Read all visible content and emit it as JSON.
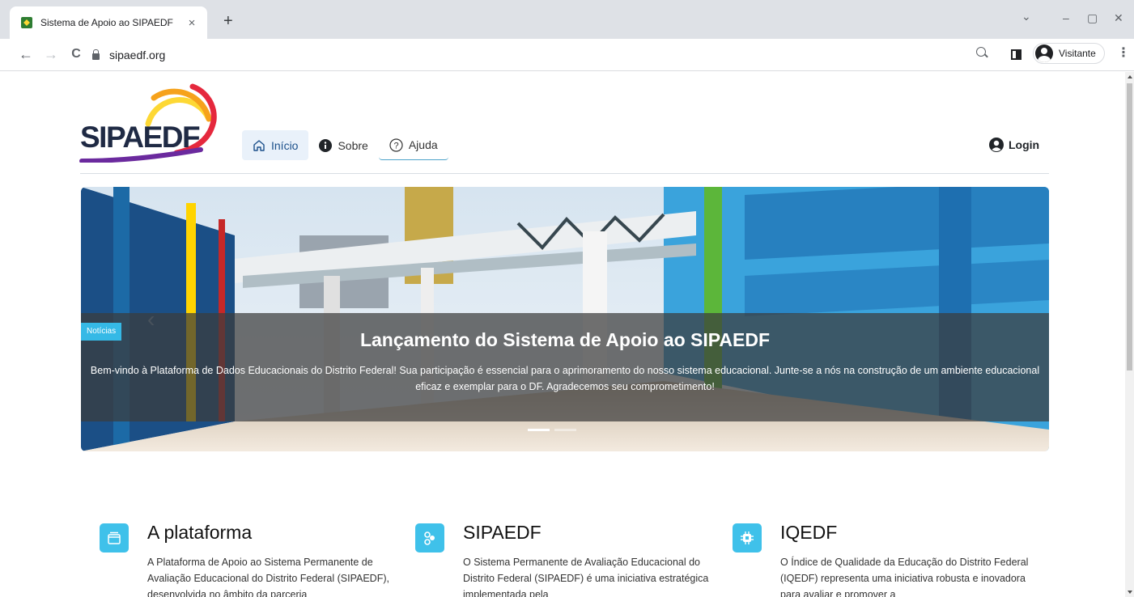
{
  "browser": {
    "tab_title": "Sistema de Apoio ao SIPAEDF",
    "tab_close": "×",
    "new_tab": "+",
    "url": "sipaedf.org",
    "profile_name": "Visitante",
    "window_controls": {
      "tabsearch": "⌄",
      "minimize": "–",
      "restore": "▢",
      "close": "✕"
    },
    "nav": {
      "back": "←",
      "forward": "→",
      "reload": "C"
    }
  },
  "site": {
    "logo_text": "SIPAEDF",
    "colors": {
      "accent": "#35b9e6",
      "logo_navy": "#1f2a44",
      "logo_purple": "#6b2a9e",
      "logo_orange": "#f6a21b",
      "logo_red": "#e5283d"
    },
    "nav": {
      "inicio": "Início",
      "sobre": "Sobre",
      "ajuda": "Ajuda",
      "login": "Login"
    },
    "carousel": {
      "badge": "Notícias",
      "title": "Lançamento do Sistema de Apoio ao SIPAEDF",
      "body": "Bem-vindo à Plataforma de Dados Educacionais do Distrito Federal! Sua participação é essencial para o aprimoramento do nosso sistema educacional. Junte-se a nós na construção de um ambiente educacional eficaz e exemplar para o DF. Agradecemos seu comprometimento!",
      "slide_count": 2,
      "active_slide": 1
    },
    "features": [
      {
        "icon": "window-icon",
        "title": "A plataforma",
        "text": "A Plataforma de Apoio ao Sistema Permanente de Avaliação Educacional do Distrito Federal (SIPAEDF), desenvolvida no âmbito da parceria"
      },
      {
        "icon": "nodes-icon",
        "title": "SIPAEDF",
        "text": "O Sistema Permanente de Avaliação Educacional do Distrito Federal (SIPAEDF) é uma iniciativa estratégica implementada pela"
      },
      {
        "icon": "chip-icon",
        "title": "IQEDF",
        "text": "O Índice de Qualidade da Educação do Distrito Federal (IQEDF) representa uma iniciativa robusta e inovadora para avaliar e promover a"
      }
    ]
  }
}
